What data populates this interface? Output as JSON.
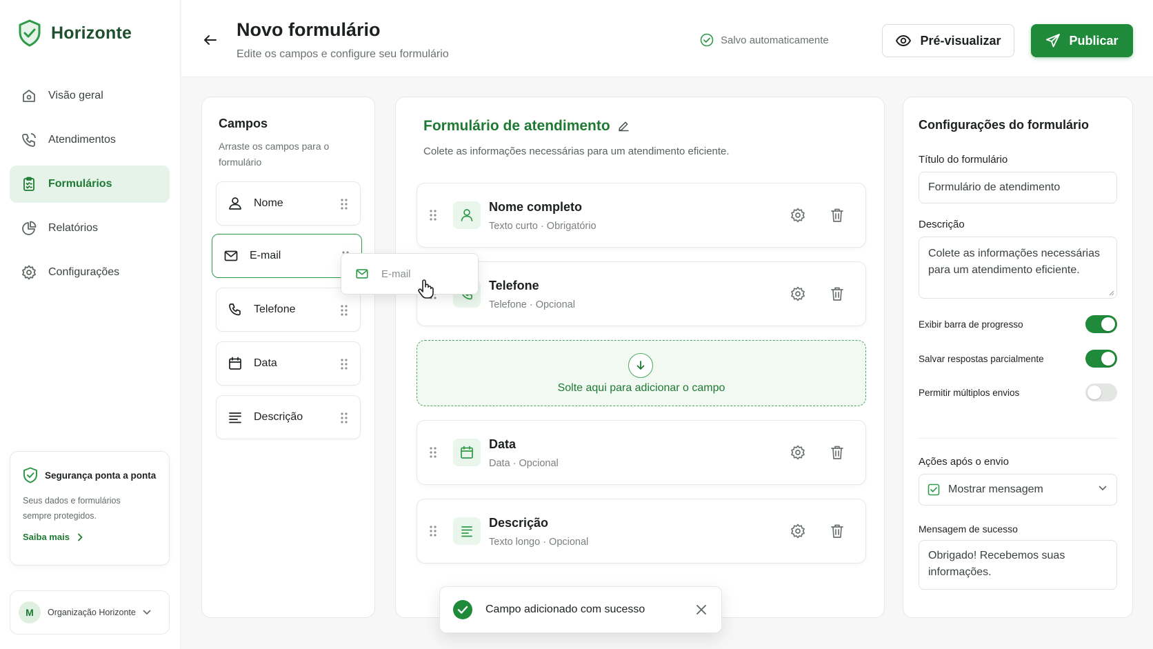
{
  "brand": {
    "name": "Horizonte",
    "icon": "shield-check-icon",
    "color": "#1e7a32"
  },
  "sidebar": {
    "items": [
      {
        "label": "Visão geral",
        "icon": "home-icon"
      },
      {
        "label": "Atendimentos",
        "icon": "phone-icon"
      },
      {
        "label": "Formulários",
        "icon": "clipboard-icon",
        "active": true
      },
      {
        "label": "Relatórios",
        "icon": "pie-chart-icon"
      },
      {
        "label": "Configurações",
        "icon": "gear-icon"
      }
    ],
    "security_card": {
      "title": "Segurança ponta a ponta",
      "text_line1": "Seus dados e formulários",
      "text_line2": "sempre protegidos.",
      "link": "Saiba mais"
    },
    "org": {
      "initial": "M",
      "name": "Organização Horizonte"
    }
  },
  "header": {
    "title": "Novo formulário",
    "subtitle": "Edite os campos e configure seu formulário",
    "autosave": "Salvo automaticamente",
    "preview_label": "Pré-visualizar",
    "publish_label": "Publicar"
  },
  "fields_panel": {
    "title": "Campos",
    "subtitle": "Arraste os campos para o formulário",
    "items": [
      {
        "label": "Nome",
        "icon": "user-icon"
      },
      {
        "label": "E-mail",
        "icon": "mail-icon",
        "selected": true
      },
      {
        "label": "Telefone",
        "icon": "phone-icon"
      },
      {
        "label": "Data",
        "icon": "calendar-icon"
      },
      {
        "label": "Descrição",
        "icon": "text-lines-icon"
      }
    ],
    "drag_ghost": "E-mail"
  },
  "form": {
    "title": "Formulário de atendimento",
    "subtitle": "Colete as informações necessárias para um atendimento eficiente.",
    "fields": [
      {
        "name": "Nome completo",
        "meta": "Texto curto · Obrigatório",
        "icon": "user-icon"
      },
      {
        "name": "Telefone",
        "meta": "Telefone · Opcional",
        "icon": "phone-icon"
      },
      {
        "name": "Data",
        "meta": "Data · Opcional",
        "icon": "calendar-icon"
      },
      {
        "name": "Descrição",
        "meta": "Texto longo · Opcional",
        "icon": "text-lines-icon"
      }
    ],
    "dropzone": "Solte aqui para adicionar o campo"
  },
  "settings": {
    "title": "Configurações do formulário",
    "form_title_label": "Título do formulário",
    "form_title_value": "Formulário de atendimento",
    "description_label": "Descrição",
    "description_value": "Colete as informações necessárias para um atendimento eficiente.",
    "toggles": [
      {
        "label": "Exibir barra de progresso",
        "on": true
      },
      {
        "label": "Salvar respostas parcialmente",
        "on": true
      },
      {
        "label": "Permitir múltiplos envios",
        "on": false
      }
    ],
    "after_submit_label": "Ações após o envio",
    "after_submit_value": "Mostrar mensagem",
    "success_label": "Mensagem de sucesso",
    "success_value": "Obrigado! Recebemos suas informações."
  },
  "toast": {
    "message": "Campo adicionado com sucesso"
  },
  "colors": {
    "accent": "#1f8a3a",
    "accent_light": "#e6f3e8",
    "text": "#1c211d",
    "muted": "#6a726c"
  }
}
